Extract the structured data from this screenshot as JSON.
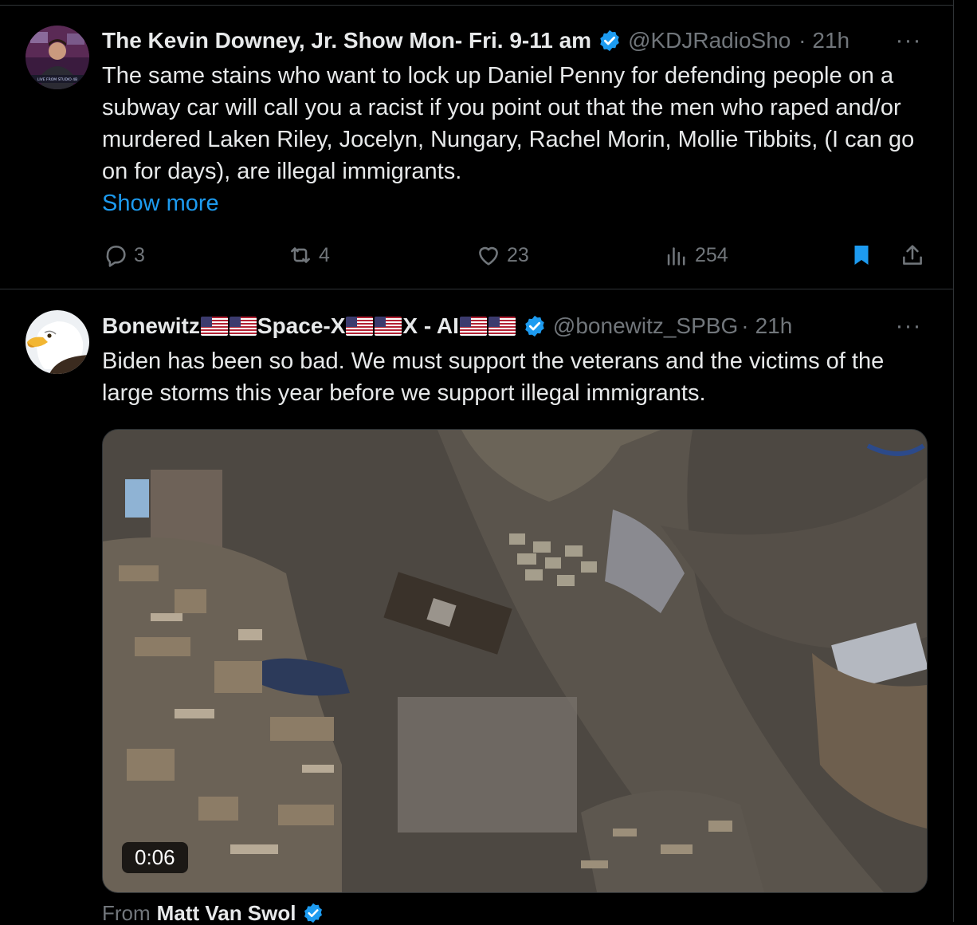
{
  "tweets": [
    {
      "author_name": "The Kevin Downey, Jr. Show Mon- Fri. 9-11 am",
      "handle": "@KDJRadioSho",
      "separator": "·",
      "time": "21h",
      "text": "The same stains who want to lock up Daniel Penny for defending people on a subway car will call you a racist if you point out that the men who raped and/or murdered Laken Riley, Jocelyn, Nungary, Rachel Morin, Mollie Tibbits, (I can go on for days), are illegal immigrants.",
      "show_more": "Show more",
      "more_icon": "···",
      "avatar_caption": "LIVE FROM STUDIO 4B",
      "stats": {
        "replies": "3",
        "reposts": "4",
        "likes": "23",
        "views": "254"
      },
      "bookmarked": true
    },
    {
      "author_name_parts": [
        "Bonewitz",
        "Space-X",
        "X - AI"
      ],
      "handle": "@bonewitz_SPBG",
      "separator": "·",
      "time": "21h",
      "text": "Biden has been so bad. We must support the veterans and the victims of the large storms this year before we support illegal immigrants.",
      "more_icon": "···",
      "video_duration": "0:06",
      "from_label": "From",
      "from_name": "Matt Van Swol"
    }
  ],
  "colors": {
    "background": "#000000",
    "text": "#e7e9ea",
    "secondary": "#71767b",
    "accent": "#1d9bf0",
    "divider": "#2f3336"
  },
  "icons": [
    "reply-icon",
    "repost-icon",
    "like-icon",
    "views-icon",
    "bookmark-icon",
    "share-icon",
    "verified-badge-icon",
    "us-flag-icon",
    "more-options-icon"
  ]
}
